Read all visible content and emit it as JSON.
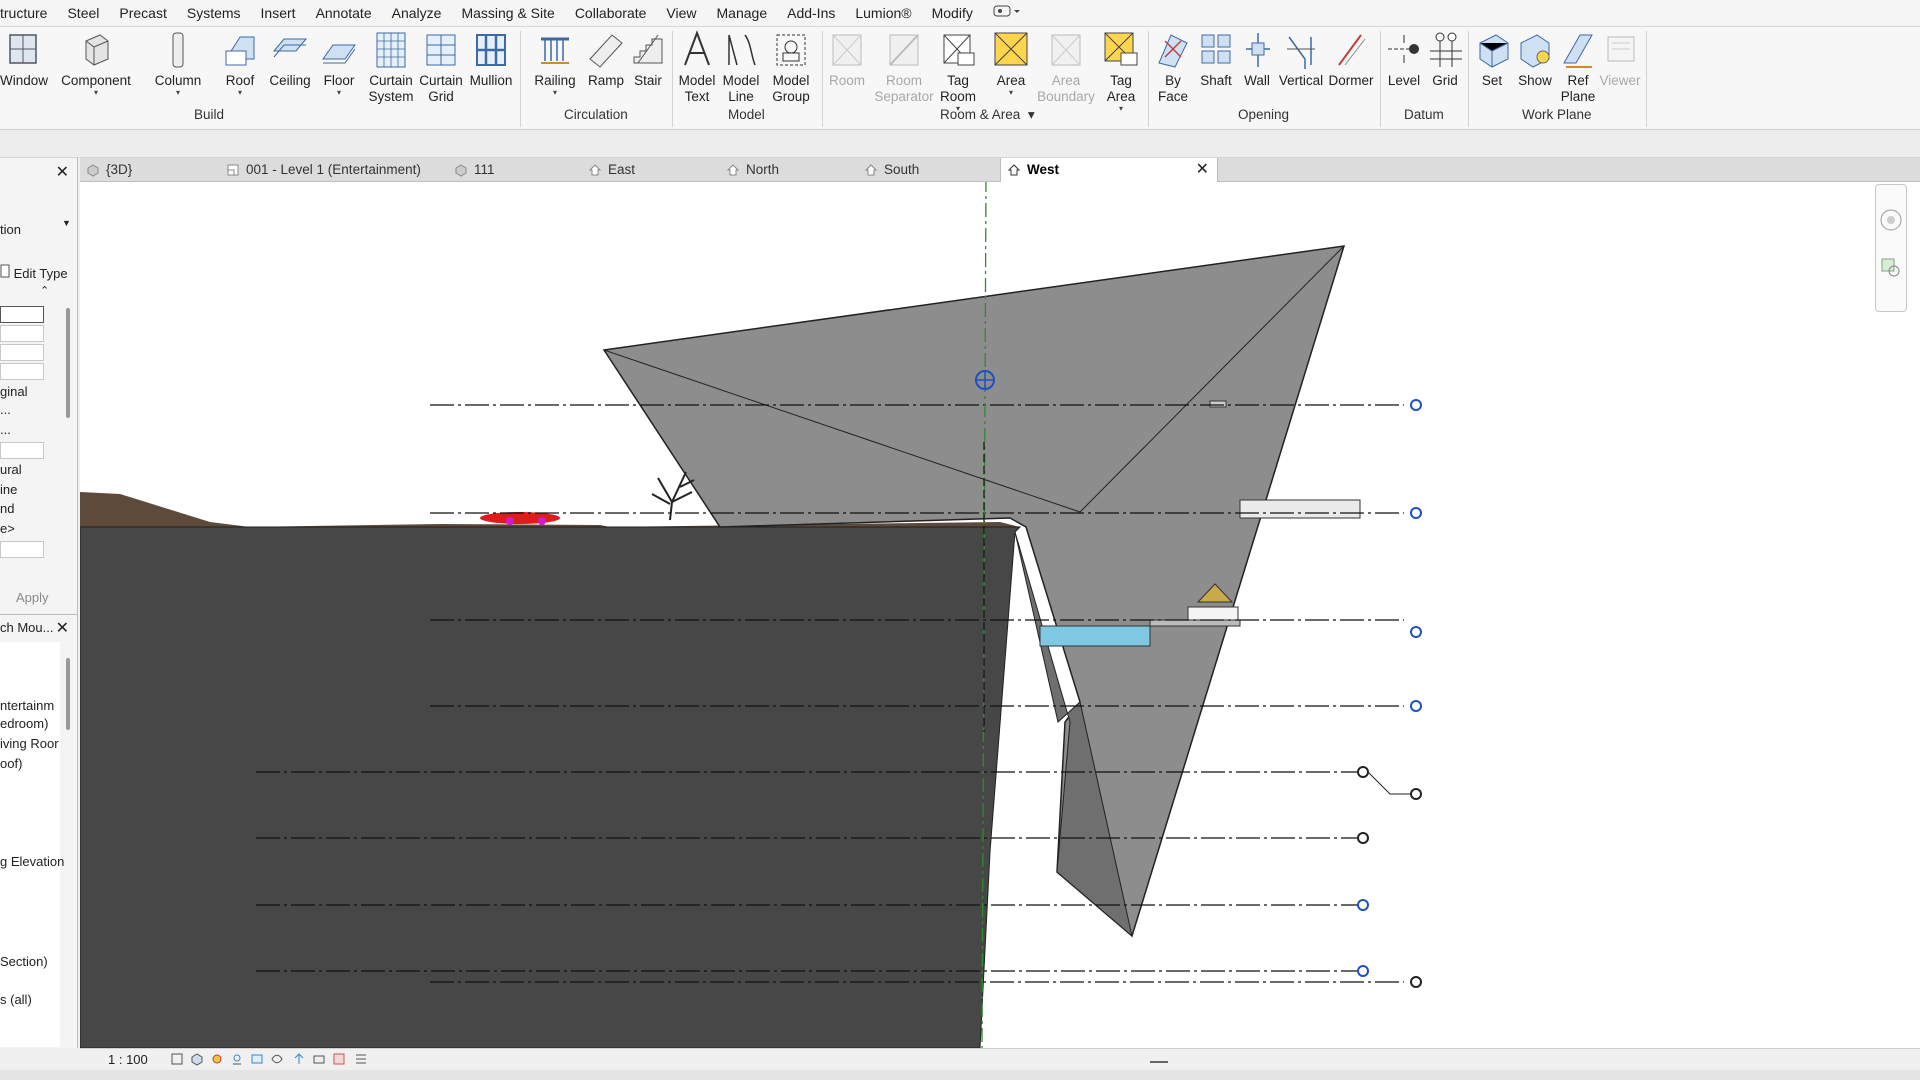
{
  "menu": [
    "tructure",
    "Steel",
    "Precast",
    "Systems",
    "Insert",
    "Annotate",
    "Analyze",
    "Massing & Site",
    "Collaborate",
    "View",
    "Manage",
    "Add-Ins",
    "Lumion®",
    "Modify"
  ],
  "ribbon": {
    "tools": {
      "window": "Window",
      "component": "Component",
      "column": "Column",
      "roof": "Roof",
      "ceiling": "Ceiling",
      "floor": "Floor",
      "curtain_system": [
        "Curtain",
        "System"
      ],
      "curtain_grid": [
        "Curtain",
        "Grid"
      ],
      "mullion": "Mullion",
      "railing": "Railing",
      "ramp": "Ramp",
      "stair": "Stair",
      "model_text": [
        "Model",
        "Text"
      ],
      "model_line": [
        "Model",
        "Line"
      ],
      "model_group": [
        "Model",
        "Group"
      ],
      "room": "Room",
      "room_separator": [
        "Room",
        "Separator"
      ],
      "tag_room": [
        "Tag",
        "Room"
      ],
      "area": "Area",
      "area_boundary": [
        "Area",
        "Boundary"
      ],
      "tag_area": [
        "Tag",
        "Area"
      ],
      "by_face": [
        "By",
        "Face"
      ],
      "shaft": "Shaft",
      "wall": "Wall",
      "vertical": "Vertical",
      "dormer": "Dormer",
      "level": "Level",
      "grid": "Grid",
      "set": "Set",
      "show": "Show",
      "ref_plane": [
        "Ref",
        "Plane"
      ],
      "viewer": "Viewer"
    },
    "panels": {
      "build": "Build",
      "circulation": "Circulation",
      "model": "Model",
      "room_area": "Room & Area",
      "opening": "Opening",
      "datum": "Datum",
      "work_plane": "Work Plane"
    }
  },
  "left_panel": {
    "type_label": "tion",
    "edit_type": "Edit Type",
    "props": [
      "ginal",
      "...",
      "...",
      "ural",
      "ine",
      "nd",
      "e>"
    ],
    "apply": "Apply",
    "browser_title": "ch Mou...",
    "browser_items": [
      "ntertainm",
      "edroom)",
      "iving Roor",
      "oof)",
      "g Elevation",
      "Section)",
      "s (all)"
    ]
  },
  "tabs": [
    {
      "label": "{3D}",
      "icon": "3d-view-icon"
    },
    {
      "label": "001 - Level 1 (Entertainment)",
      "icon": "floor-plan-icon"
    },
    {
      "label": "111",
      "icon": "3d-view-icon"
    },
    {
      "label": "East",
      "icon": "elevation-icon"
    },
    {
      "label": "North",
      "icon": "elevation-icon"
    },
    {
      "label": "South",
      "icon": "elevation-icon"
    },
    {
      "label": "West",
      "icon": "elevation-icon",
      "active": true
    }
  ],
  "view_control": {
    "scale": "1 : 100"
  },
  "colors": {
    "ground_dark": "#444444",
    "mass_gray": "#8c8c8c",
    "water": "#7ec8e3",
    "grid_line": "#2e8b2e",
    "level_marker": "#2050c0"
  }
}
